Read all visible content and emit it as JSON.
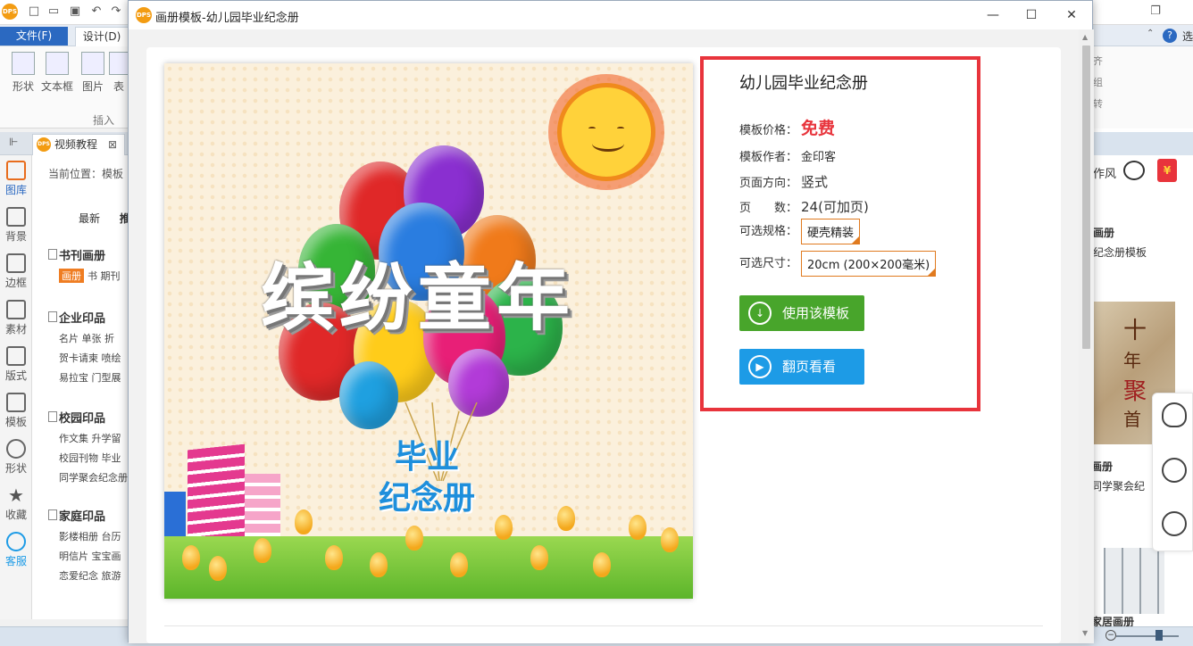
{
  "app": {
    "file_tab": "文件(F)",
    "design_tab": "设计(D)",
    "ribbon_buttons": [
      "形状",
      "文本框",
      "图片",
      "表"
    ],
    "ribbon_group": "插入",
    "doc_tab": "视频教程",
    "doc_tab_close": "⊠",
    "left_bar": [
      "图库",
      "背景",
      "边框",
      "素材",
      "版式",
      "模板",
      "形状",
      "收藏",
      "客服"
    ],
    "crumb": "当前位置：模板",
    "cat_tabs": [
      "最新",
      "推"
    ],
    "sections": [
      {
        "head": "书刊画册",
        "rows": [
          "画册 书 期刊"
        ]
      },
      {
        "head": "企业印品",
        "rows": [
          "名片 单张 折",
          "贺卡请柬 喷绘",
          "易拉宝 门型展"
        ]
      },
      {
        "head": "校园印品",
        "rows": [
          "作文集 升学留",
          "校园刊物 毕业",
          "同学聚会纪念册"
        ]
      },
      {
        "head": "家庭印品",
        "rows": [
          "影楼相册 台历",
          "明信片 宝宝画",
          "恋爱纪念 旅游"
        ]
      }
    ],
    "right_ribbon": [
      "齐",
      "组",
      "转"
    ],
    "right_feng": "作风",
    "right_card1_title": "画册",
    "right_card1_sub": "纪念册模板",
    "right_card2_chars": [
      "十",
      "年",
      "聚",
      "首"
    ],
    "right_card2_title": "画册",
    "right_card2_sub": "同学聚会纪",
    "right_card3_title": "家居画册",
    "right_top_label": "选"
  },
  "modal": {
    "title": "画册模板-幼儿园毕业纪念册",
    "controls": {
      "minimize": "—",
      "maximize": "☐",
      "close": "✕"
    },
    "preview": {
      "title": "缤纷童年",
      "sub1": "毕业",
      "sub2": "纪念册"
    },
    "info": {
      "name": "幼儿园毕业纪念册",
      "price_label": "模板价格：",
      "price_value": "免费",
      "author_label": "模板作者：",
      "author_value": "金印客",
      "orientation_label": "页面方向：",
      "orientation_value": "竖式",
      "pages_label": "页　　数：",
      "pages_value": "24(可加页)",
      "spec_label": "可选规格：",
      "spec_value": "硬壳精装",
      "size_label": "可选尺寸：",
      "size_value": "20cm (200×200毫米)",
      "use_button": "使用该模板",
      "flip_button": "翻页看看"
    }
  },
  "colors": {
    "accent_red": "#e8343c",
    "use_green": "#48a52b",
    "flip_blue": "#1d9be6",
    "brand_blue": "#2b69c1"
  }
}
